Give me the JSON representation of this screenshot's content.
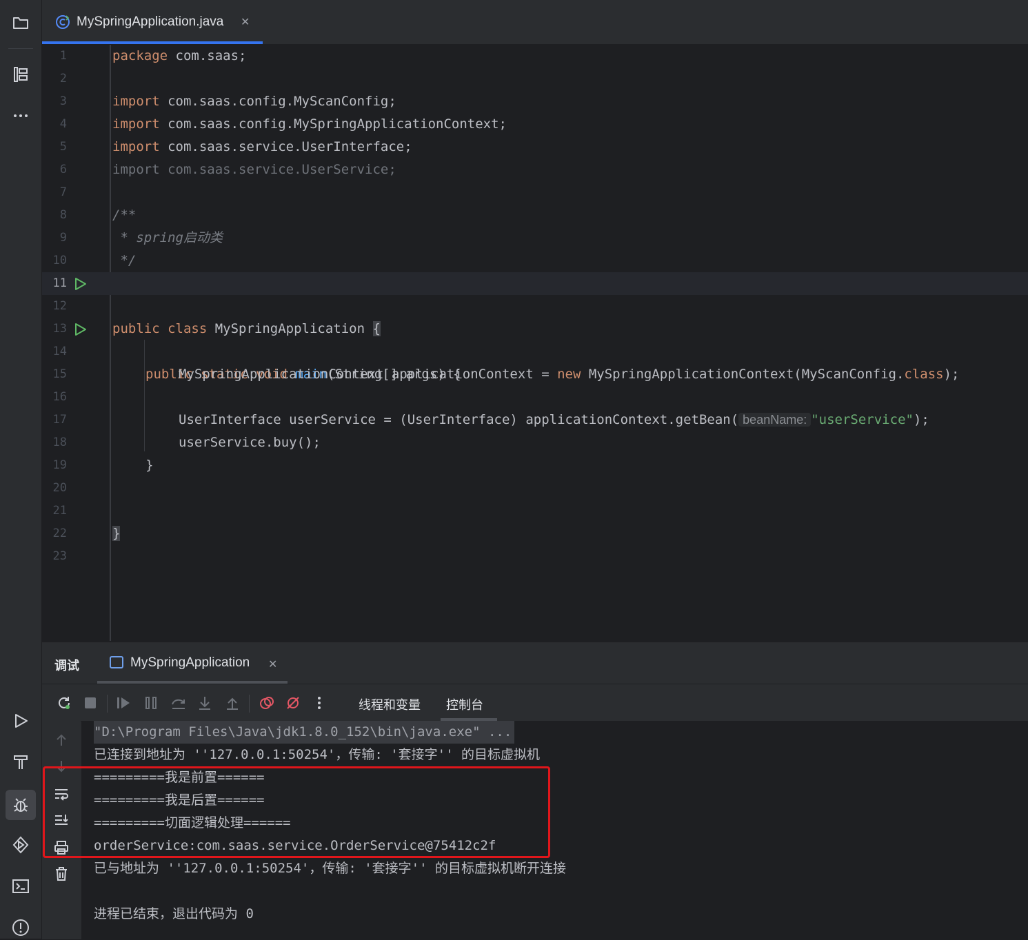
{
  "activity_bar": {
    "top_icons": [
      "folder-icon",
      "structure-icon",
      "more-icon"
    ],
    "bottom_icons": [
      "run-icon",
      "build-icon",
      "debug-icon",
      "services-icon",
      "terminal-icon",
      "problems-icon"
    ],
    "selected": "debug-icon"
  },
  "editor_tab": {
    "label": "MySpringApplication.java",
    "close": "✕"
  },
  "editor": {
    "current_line": 11,
    "line_numbers": [
      "1",
      "2",
      "3",
      "4",
      "5",
      "6",
      "7",
      "8",
      "9",
      "10",
      "11",
      "12",
      "13",
      "14",
      "15",
      "16",
      "17",
      "18",
      "19",
      "20",
      "21",
      "22",
      "23"
    ],
    "code": {
      "l1_kw": "package",
      "l1_rest": " com.saas;",
      "l3_kw": "import",
      "l3_rest": " com.saas.config.MyScanConfig;",
      "l4_kw": "import",
      "l4_rest": " com.saas.config.MySpringApplicationContext;",
      "l5_kw": "import",
      "l5_rest": " com.saas.service.UserInterface;",
      "l6": "import com.saas.service.UserService;",
      "l8": "/**",
      "l9": " * spring启动类",
      "l10": " */",
      "l11_kw": "public class",
      "l11_name": " MySpringApplication ",
      "l11_brace": "{",
      "l13_kw": "public static void",
      "l13_fn": "main",
      "l13_rest": "(String[] args) {",
      "l15_a": "MySpringApplicationContext applicationContext = ",
      "l15_kw": "new",
      "l15_b": " MySpringApplicationContext(MyScanConfig.",
      "l15_kw2": "class",
      "l15_c": ");",
      "l17_a": "UserInterface userService = (UserInterface) applicationContext.getBean(",
      "l17_hint": "beanName:",
      "l17_str": "\"userService\"",
      "l17_c": ");",
      "l18": "userService.buy();",
      "l19": "}",
      "l22": "}"
    }
  },
  "debug_panel": {
    "title": "调试",
    "run_tab_label": "MySpringApplication",
    "run_tab_close": "✕",
    "sub_tabs": [
      "线程和变量",
      "控制台"
    ],
    "active_sub_tab": "控制台",
    "console_lines": [
      "\"D:\\Program Files\\Java\\jdk1.8.0_152\\bin\\java.exe\" ...",
      "已连接到地址为 ''127.0.0.1:50254'，传输: '套接字'' 的目标虚拟机",
      "=========我是前置======",
      "=========我是后置======",
      "=========切面逻辑处理======",
      "orderService:com.saas.service.OrderService@75412c2f",
      "已与地址为 ''127.0.0.1:50254'，传输: '套接字'' 的目标虚拟机断开连接",
      "",
      "进程已结束，退出代码为 0"
    ]
  },
  "colors": {
    "accent": "#3574f0",
    "highlight_box": "#e0161b",
    "keyword": "#cf8e6d",
    "string": "#6aab73",
    "function": "#56a8f5",
    "run_marker": "#5fb865"
  }
}
